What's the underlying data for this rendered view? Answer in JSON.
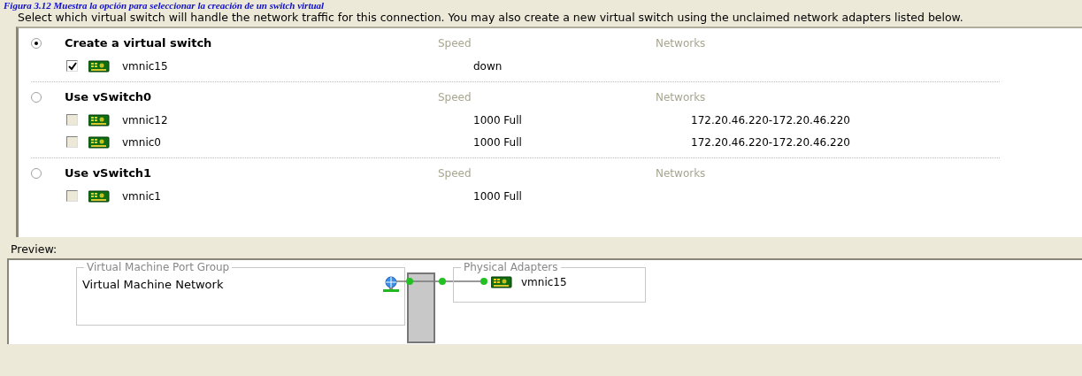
{
  "caption": "Figura 3.12 Muestra la opción para seleccionar la creación de un switch virtual",
  "instructions": "Select which virtual switch will handle the network traffic for this connection. You may also create a new virtual switch using the unclaimed network adapters listed below.",
  "groups": [
    {
      "label": "Create a virtual switch",
      "selected": true,
      "speed_header": "Speed",
      "networks_header": "Networks",
      "adapters": [
        {
          "name": "vmnic15",
          "checked": true,
          "disabled": false,
          "speed": "down"
        }
      ]
    },
    {
      "label": "Use vSwitch0",
      "selected": false,
      "speed_header": "Speed",
      "networks_header": "Networks",
      "adapters": [
        {
          "name": "vmnic12",
          "checked": false,
          "disabled": true,
          "speed": "1000 Full",
          "networks": "172.20.46.220-172.20.46.220"
        },
        {
          "name": "vmnic0",
          "checked": false,
          "disabled": true,
          "speed": "1000 Full",
          "networks": "172.20.46.220-172.20.46.220"
        }
      ]
    },
    {
      "label": "Use vSwitch1",
      "selected": false,
      "speed_header": "Speed",
      "networks_header": "Networks",
      "adapters": [
        {
          "name": "vmnic1",
          "checked": false,
          "disabled": true,
          "speed": "1000 Full"
        }
      ]
    }
  ],
  "preview": {
    "label": "Preview:",
    "port_group": {
      "title": "Virtual Machine Port Group",
      "name": "Virtual Machine Network"
    },
    "physical_adapters": {
      "title": "Physical Adapters",
      "adapters": [
        "vmnic15"
      ]
    }
  }
}
